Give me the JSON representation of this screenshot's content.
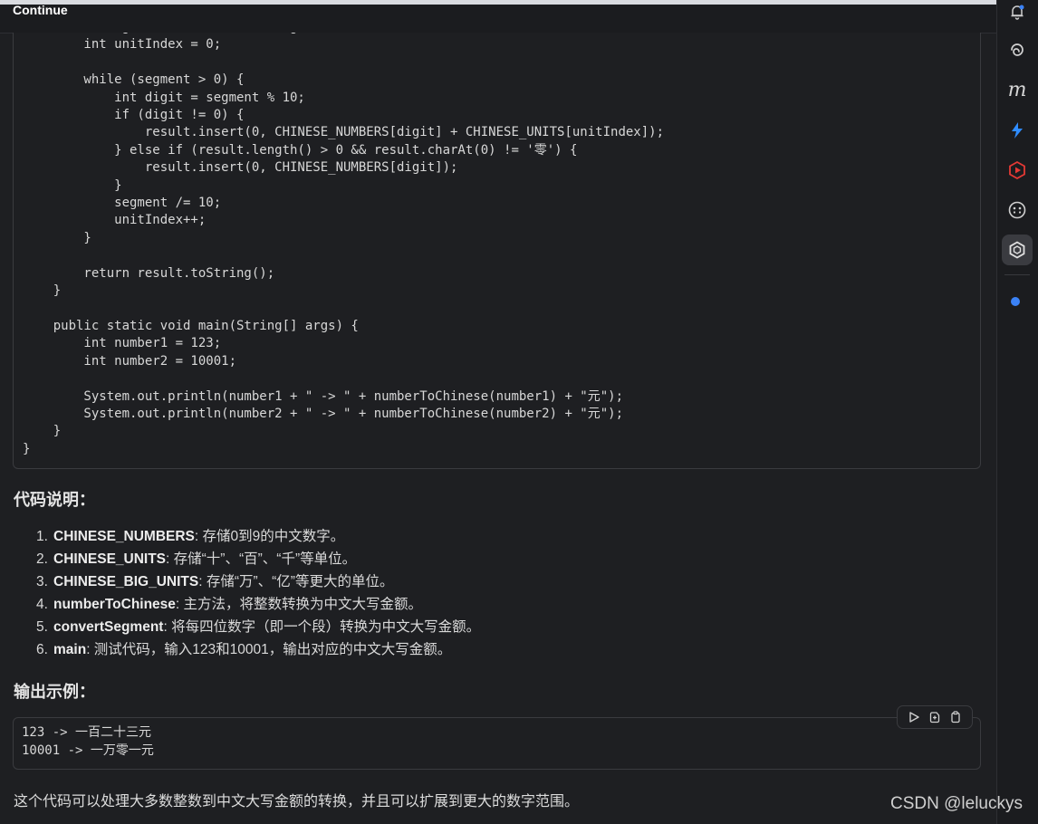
{
  "header": {
    "title": "Continue"
  },
  "code_block": {
    "text": "        String unitNames = newStringBuilder();\n        int unitIndex = 0;\n\n        while (segment > 0) {\n            int digit = segment % 10;\n            if (digit != 0) {\n                result.insert(0, CHINESE_NUMBERS[digit] + CHINESE_UNITS[unitIndex]);\n            } else if (result.length() > 0 && result.charAt(0) != '零') {\n                result.insert(0, CHINESE_NUMBERS[digit]);\n            }\n            segment /= 10;\n            unitIndex++;\n        }\n\n        return result.toString();\n    }\n\n    public static void main(String[] args) {\n        int number1 = 123;\n        int number2 = 10001;\n\n        System.out.println(number1 + \" -> \" + numberToChinese(number1) + \"元\");\n        System.out.println(number2 + \" -> \" + numberToChinese(number2) + \"元\");\n    }\n}"
  },
  "explanation": {
    "heading": "代码说明：",
    "items": [
      {
        "num": "1.",
        "term": "CHINESE_NUMBERS",
        "desc": ": 存储0到9的中文数字。"
      },
      {
        "num": "2.",
        "term": "CHINESE_UNITS",
        "desc": ": 存储“十”、“百”、“千”等单位。"
      },
      {
        "num": "3.",
        "term": "CHINESE_BIG_UNITS",
        "desc": ": 存储“万”、“亿”等更大的单位。"
      },
      {
        "num": "4.",
        "term": "numberToChinese",
        "desc": ": 主方法，将整数转换为中文大写金额。"
      },
      {
        "num": "5.",
        "term": "convertSegment",
        "desc": ": 将每四位数字（即一个段）转换为中文大写金额。"
      },
      {
        "num": "6.",
        "term": "main",
        "desc": ": 测试代码，输入123和10001，输出对应的中文大写金额。"
      }
    ]
  },
  "output": {
    "heading": "输出示例：",
    "text": "123 -> 一百二十三元\n10001 -> 一万零一元",
    "tools": {
      "run": "play-icon",
      "insert": "insert-icon",
      "copy": "copy-icon"
    }
  },
  "summary": "这个代码可以处理大多数整数到中文大写金额的转换，并且可以扩展到更大的数字范围。",
  "watermark": "CSDN @leluckys",
  "sidebar": {
    "icons": [
      "bell-icon",
      "spiral-icon",
      "m-icon",
      "lightning-icon",
      "play-hex-icon",
      "face-icon",
      "continue-icon"
    ],
    "active": "continue-icon",
    "accent": "#3b82f6"
  }
}
